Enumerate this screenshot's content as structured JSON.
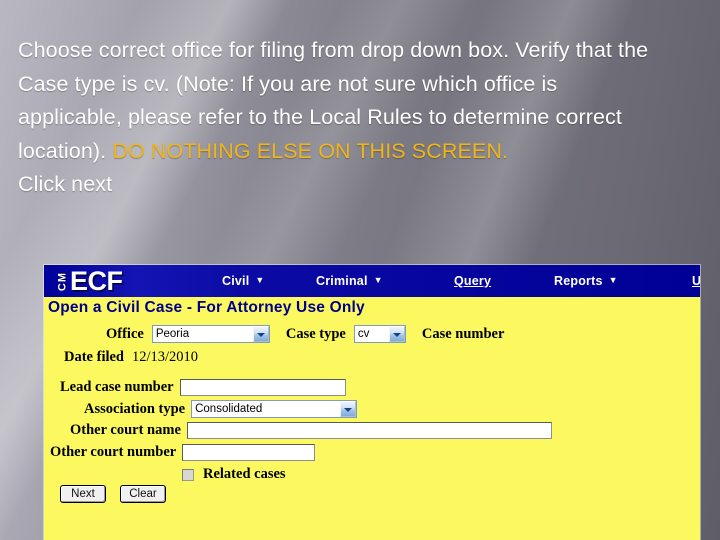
{
  "slide": {
    "body_lines": [
      "Choose correct office for filing from drop down box. Verify that the Case type is cv. (Note: If you are not sure which office is applicable, please refer to the Local Rules to determine correct location). ",
      "Click next"
    ],
    "warning_text": "DO NOTHING ELSE ON THIS SCREEN.",
    "warning_color": "#f0b518",
    "text_color": "#ffffff"
  },
  "ecf": {
    "logo": {
      "cm": "CM",
      "ecf": "ECF"
    },
    "nav": [
      {
        "label": "Civil",
        "accesskey": "i",
        "has_caret": true
      },
      {
        "label": "Criminal",
        "accesskey": "n",
        "has_caret": true
      },
      {
        "label": "Query",
        "accesskey": "Q",
        "has_caret": false
      },
      {
        "label": "Reports",
        "accesskey": "",
        "has_caret": true
      },
      {
        "label": "U",
        "accesskey": "U",
        "has_caret": false
      }
    ],
    "nav_labels": {
      "civil": "Civil",
      "criminal": "Criminal",
      "query": "Query",
      "reports": "Reports",
      "utilities": "U"
    },
    "page_title": "Open a Civil Case - For Attorney Use Only",
    "form": {
      "office_label": "Office",
      "office_value": "Peoria",
      "case_type_label": "Case type",
      "case_type_value": "cv",
      "case_number_label": "Case number",
      "date_filed_label": "Date filed",
      "date_filed_value": "12/13/2010",
      "lead_case_number_label": "Lead case number",
      "lead_case_number_value": "",
      "association_type_label": "Association type",
      "association_type_value": "Consolidated",
      "other_court_name_label": "Other court name",
      "other_court_name_value": "",
      "other_court_number_label": "Other court number",
      "other_court_number_value": "",
      "related_cases_label": "Related cases",
      "related_cases_checked": false,
      "next_button": "Next",
      "clear_button": "Clear"
    },
    "colors": {
      "nav_bar": "#00009a",
      "page_background": "#fbf95f",
      "title_text": "#00008c"
    }
  }
}
